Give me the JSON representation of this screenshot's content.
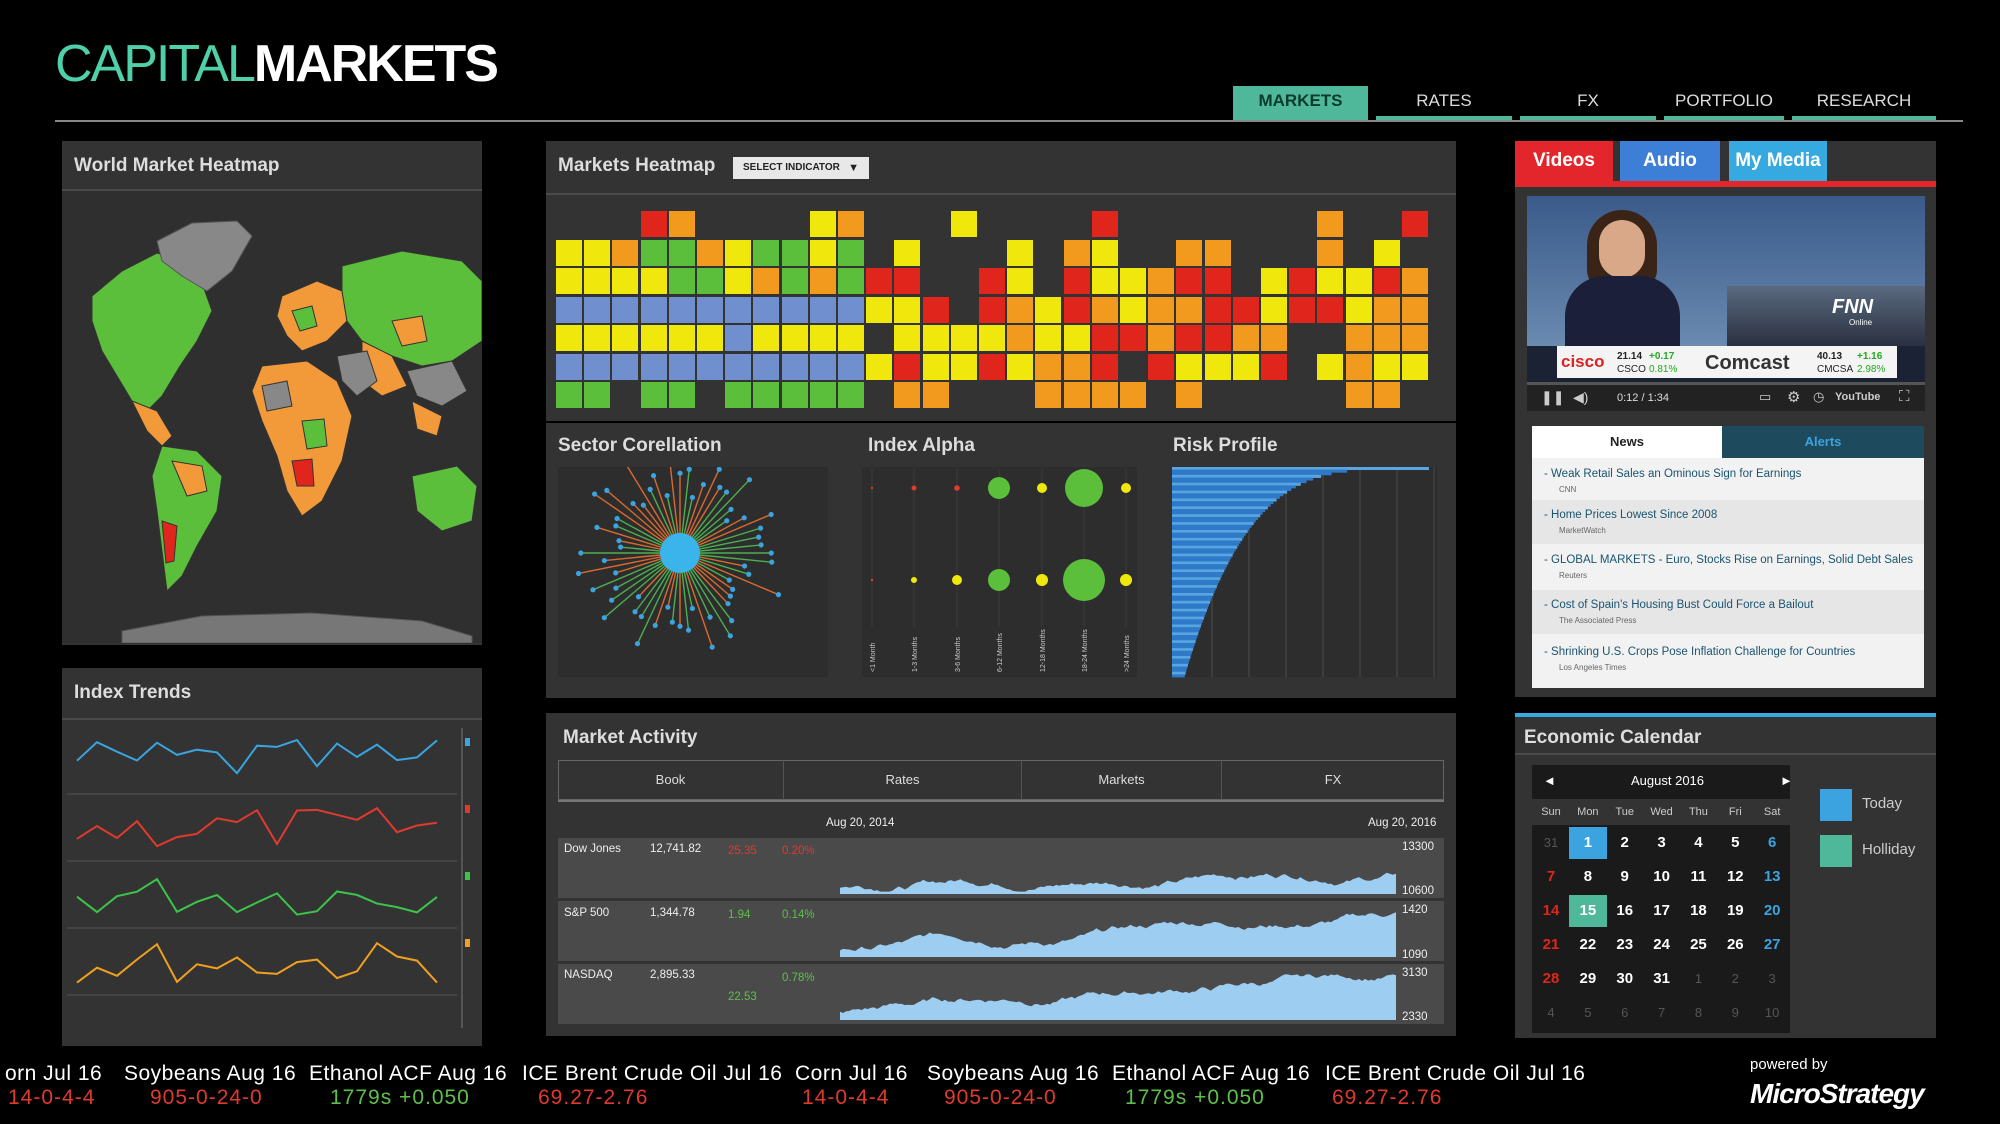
{
  "logo": {
    "part1": "CAPITAL",
    "part2": "MARKETS"
  },
  "nav": {
    "tabs": [
      {
        "label": "MARKETS",
        "active": true
      },
      {
        "label": "RATES",
        "active": false
      },
      {
        "label": "FX",
        "active": false
      },
      {
        "label": "PORTFOLIO",
        "active": false
      },
      {
        "label": "RESEARCH",
        "active": false
      }
    ]
  },
  "world_heatmap": {
    "title": "World Market Heatmap"
  },
  "index_trends": {
    "title": "Index Trends",
    "colors": [
      "#3aa4e0",
      "#e03a2e",
      "#3cc44a",
      "#f0a020"
    ]
  },
  "markets_heatmap": {
    "title": "Markets Heatmap",
    "select_label": "SELECT INDICATOR",
    "colors": {
      "R": "#e0261c",
      "O": "#f29a1e",
      "Y": "#f0e80c",
      "G": "#5cbf3c",
      "B": "#6f8fcf"
    }
  },
  "sector_correlation": {
    "title": "Sector Corellation"
  },
  "index_alpha": {
    "title": "Index Alpha",
    "columns": [
      "<1 Month",
      "1-3 Months",
      "3-6 Months",
      "6-12 Months",
      "12-18 Months",
      "18-24 Months",
      ">24 Months"
    ]
  },
  "risk_profile": {
    "title": "Risk Profile"
  },
  "market_activity": {
    "title": "Market Activity",
    "columns": [
      "Book",
      "Rates",
      "Markets",
      "FX"
    ],
    "date_start": "Aug 20, 2014",
    "date_end": "Aug 20, 2016",
    "rows": [
      {
        "name": "Dow Jones",
        "value": "12,741.82",
        "change": "25.35",
        "pct": "0.20%",
        "change_color": "#e03a2e",
        "high": "13300",
        "low": "10600"
      },
      {
        "name": "S&P 500",
        "value": "1,344.78",
        "change": "1.94",
        "pct": "0.14%",
        "change_color": "#5ec04a",
        "high": "1420",
        "low": "1090"
      },
      {
        "name": "NASDAQ",
        "value": "2,895.33",
        "change": "22.53",
        "pct": "0.78%",
        "change_color": "#5ec04a",
        "high": "3130",
        "low": "2330"
      }
    ]
  },
  "media": {
    "tabs": [
      {
        "label": "Videos",
        "color": "#e3262b"
      },
      {
        "label": "Audio",
        "color": "#3d7ed6"
      },
      {
        "label": "My Media",
        "color": "#35a9e0"
      }
    ],
    "video": {
      "time": "0:12 / 1:34",
      "brand": "FNN",
      "brand_sub": "Online",
      "ticker1_name": "cisco",
      "ticker1_price": "21.14",
      "ticker1_change": "+0.17",
      "ticker1_sym": "CSCO",
      "ticker1_pct": "0.81%",
      "ticker2_name": "Comcast",
      "ticker2_price": "40.13",
      "ticker2_change": "+1.16",
      "ticker2_sym": "CMCSA",
      "ticker2_pct": "2.98%",
      "youtube": "YouTube"
    },
    "news_tabs": [
      "News",
      "Alerts"
    ],
    "news": [
      {
        "headline": "- Weak Retail Sales an Ominous Sign for Earnings",
        "source": "CNN"
      },
      {
        "headline": "- Home Prices Lowest Since 2008",
        "source": "MarketWatch"
      },
      {
        "headline": "- GLOBAL MARKETS - Euro, Stocks Rise on Earnings, Solid Debt Sales",
        "source": "Reuters"
      },
      {
        "headline": "- Cost of Spain's Housing Bust Could Force a Bailout",
        "source": "The Associated Press"
      },
      {
        "headline": "- Shrinking U.S. Crops Pose Inflation Challenge for Countries",
        "source": "Los Angeles Times"
      }
    ]
  },
  "calendar": {
    "title": "Economic Calendar",
    "month": "August 2016",
    "prev": "◄",
    "next": "►",
    "days": [
      "Sun",
      "Mon",
      "Tue",
      "Wed",
      "Thu",
      "Fri",
      "Sat"
    ],
    "weeks": [
      [
        "31",
        "1",
        "2",
        "3",
        "4",
        "5",
        "6"
      ],
      [
        "7",
        "8",
        "9",
        "10",
        "11",
        "12",
        "13"
      ],
      [
        "14",
        "15",
        "16",
        "17",
        "18",
        "19",
        "20"
      ],
      [
        "21",
        "22",
        "23",
        "24",
        "25",
        "26",
        "27"
      ],
      [
        "28",
        "29",
        "30",
        "31",
        "1",
        "2",
        "3"
      ],
      [
        "4",
        "5",
        "6",
        "7",
        "8",
        "9",
        "10"
      ]
    ],
    "legend": [
      {
        "label": "Today",
        "color": "#3aa3e0"
      },
      {
        "label": "Holliday",
        "color": "#4fb89a"
      }
    ]
  },
  "ticker": [
    {
      "name": "orn  Jul 16",
      "value": "14-0-4-4",
      "color": "#e03a2e"
    },
    {
      "name": "Soybeans  Aug 16",
      "value": "905-0-24-0",
      "color": "#e03a2e"
    },
    {
      "name": "Ethanol ACF  Aug 16",
      "value": "1779s +0.050",
      "color": "#5ec04a"
    },
    {
      "name": "ICE Brent Crude Oil  Jul 16",
      "value": "69.27-2.76",
      "color": "#e03a2e"
    },
    {
      "name": "Corn  Jul 16",
      "value": "14-0-4-4",
      "color": "#e03a2e"
    },
    {
      "name": "Soybeans  Aug 16",
      "value": "905-0-24-0",
      "color": "#e03a2e"
    },
    {
      "name": "Ethanol ACF  Aug 16",
      "value": "1779s +0.050",
      "color": "#5ec04a"
    },
    {
      "name": "ICE Brent Crude Oil  Jul 16",
      "value": "69.27-2.76",
      "color": "#e03a2e"
    }
  ],
  "footer": {
    "powered_by": "powered by",
    "brand": "MicroStrategy"
  }
}
